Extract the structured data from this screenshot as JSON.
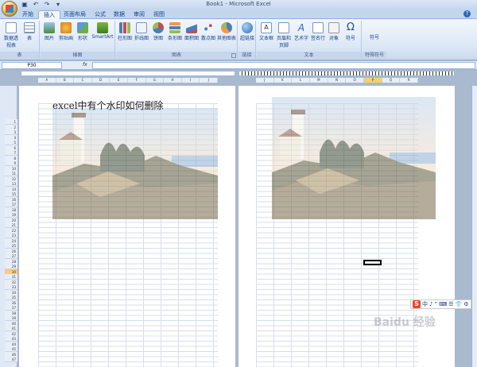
{
  "window": {
    "title": "Book1 - Microsoft Excel"
  },
  "tabs": [
    "开始",
    "插入",
    "页面布局",
    "公式",
    "数据",
    "审阅",
    "视图"
  ],
  "active_tab": "插入",
  "ribbon": {
    "groups": [
      {
        "label": "表",
        "buttons": [
          "数据透视表",
          "表"
        ]
      },
      {
        "label": "插图",
        "buttons": [
          "图片",
          "剪贴画",
          "形状",
          "SmartArt"
        ]
      },
      {
        "label": "图表",
        "buttons": [
          "柱形图",
          "折线图",
          "饼图",
          "条形图",
          "面积图",
          "散点图",
          "其他图表"
        ]
      },
      {
        "label": "链接",
        "buttons": [
          "超链接"
        ]
      },
      {
        "label": "文本",
        "buttons": [
          "文本框",
          "页眉和页脚",
          "艺术字",
          "签名行",
          "对象",
          "符号"
        ]
      },
      {
        "label": "特殊符号",
        "buttons": [
          "符号"
        ]
      }
    ]
  },
  "formula_bar": {
    "name_box": "P30",
    "fx": "fx",
    "value": ""
  },
  "columns_left": [
    "A",
    "B",
    "C",
    "D",
    "E",
    "F",
    "G",
    "H",
    "I",
    "J"
  ],
  "columns_right": [
    "J",
    "K",
    "L",
    "M",
    "N",
    "O",
    "P",
    "Q",
    "R"
  ],
  "selected_column": "P",
  "row_numbers": [
    "1",
    "2",
    "3",
    "4",
    "5",
    "6",
    "7",
    "8",
    "9",
    "10",
    "11",
    "12",
    "13",
    "14",
    "15",
    "16",
    "17",
    "18",
    "19",
    "20",
    "21",
    "22",
    "23",
    "24",
    "25",
    "26",
    "27",
    "28",
    "29",
    "30",
    "31",
    "32",
    "33",
    "34",
    "35",
    "36",
    "37",
    "38",
    "39",
    "40",
    "41",
    "42",
    "43",
    "44",
    "45",
    "46",
    "47"
  ],
  "selected_row": "30",
  "sheet": {
    "title_text": "excel中有个水印如何删除"
  },
  "ime_toolbar": {
    "logo": "S",
    "items": [
      "中",
      "♪",
      "”",
      "⌨",
      "☰",
      "👕",
      "⚙"
    ]
  },
  "watermark_text": "Baidu 经验"
}
